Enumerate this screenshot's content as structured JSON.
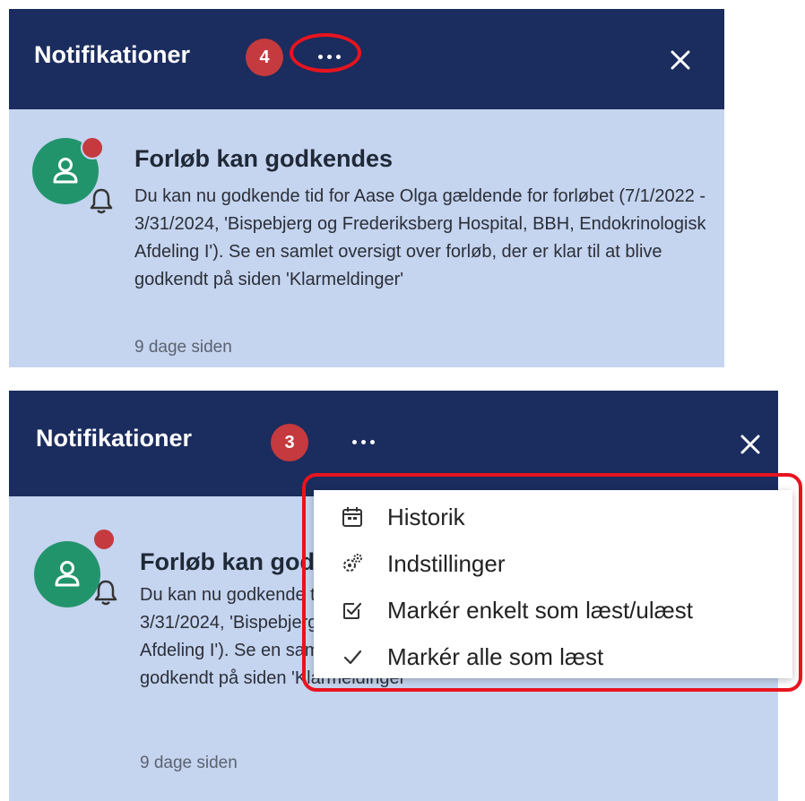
{
  "colors": {
    "header_bg": "#1b2c5e",
    "panel_bg": "#c5d4ef",
    "badge": "#c53a3e",
    "avatar": "#22946c",
    "annotation": "#e8141e"
  },
  "top_panel": {
    "title": "Notifikationer",
    "badge_count": "4",
    "more_icon": "more-horizontal-icon",
    "close_icon": "close-icon",
    "notification": {
      "avatar_icon": "person-icon",
      "bell_icon": "bell-icon",
      "title": "Forløb kan godkendes",
      "body": "Du kan nu godkende tid for Aase Olga gældende for forløbet (7/1/2022 - 3/31/2024, 'Bispebjerg og Frederiksberg Hospital, BBH, Endokrinologisk Afdeling I'). Se en samlet oversigt over forløb, der er klar til at blive godkendt på siden 'Klarmeldinger'",
      "time": "9 dage siden"
    }
  },
  "bottom_panel": {
    "title": "Notifikationer",
    "badge_count": "3",
    "more_icon": "more-horizontal-icon",
    "close_icon": "close-icon",
    "notification": {
      "avatar_icon": "person-icon",
      "bell_icon": "bell-icon",
      "title": "Forløb kan godkendes",
      "body": "Du kan nu godkende tid for Aase Olga gældende for forløbet (7/1/2022 - 3/31/2024, 'Bispebjerg og Frederiksberg Hospital, BBH, Endokrinologisk Afdeling I'). Se en samlet oversigt over forløb, der er klar til at blive godkendt på siden 'Klarmeldinger'",
      "time": "9 dage siden"
    },
    "menu": [
      {
        "label": "Historik",
        "icon": "calendar-icon"
      },
      {
        "label": "Indstillinger",
        "icon": "gears-icon"
      },
      {
        "label": "Markér enkelt som læst/ulæst",
        "icon": "checkbox-icon"
      },
      {
        "label": "Markér alle som læst",
        "icon": "checkmark-icon"
      }
    ]
  }
}
